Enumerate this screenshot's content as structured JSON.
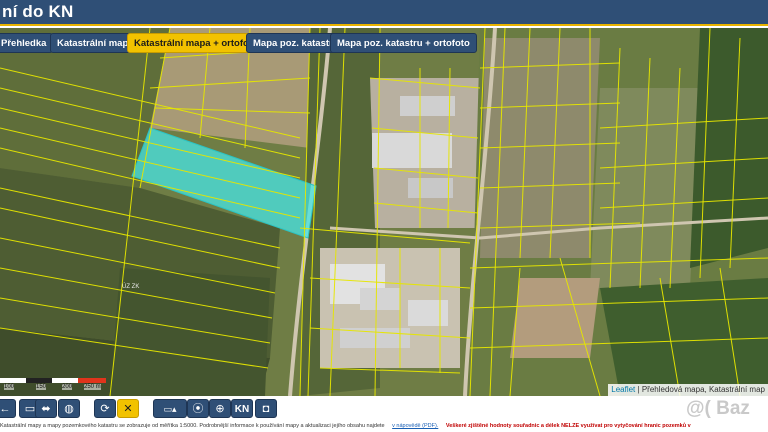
{
  "header": {
    "title": "ní do KN"
  },
  "tabs": [
    {
      "label": "Přehledka",
      "active": false
    },
    {
      "label": "Katastrální mapa",
      "active": false
    },
    {
      "label": "Katastrální mapa + ortofoto",
      "active": true
    },
    {
      "label": "Mapa poz. katastru",
      "active": false
    },
    {
      "label": "Mapa poz. katastru + ortofoto",
      "active": false
    }
  ],
  "map": {
    "parcel_label": "ÚZ ZK",
    "scale_labels": [
      "100",
      "150",
      "200",
      "250 m"
    ],
    "attribution": {
      "leaflet": "Leaflet",
      "text": "| Přehledová mapa, Katastrální map"
    },
    "colors": {
      "parcel_line": "#e6e600",
      "selected": "#46e6e6",
      "accent": "#f2c200",
      "brand": "#2f4f76"
    }
  },
  "toolbar": {
    "buttons": [
      {
        "name": "arrow-left-icon",
        "glyph": "←"
      },
      {
        "name": "arrow-right-icon",
        "glyph": "▭"
      },
      {
        "name": "move-icon",
        "glyph": "⬌"
      },
      {
        "name": "globe-icon",
        "glyph": "◍"
      },
      {
        "name": "refresh-icon",
        "glyph": "⟳"
      },
      {
        "name": "close-icon",
        "glyph": "✕"
      },
      {
        "name": "measure-icon",
        "glyph": "▭▴"
      },
      {
        "name": "location-icon",
        "glyph": "⦿"
      },
      {
        "name": "crosshair-icon",
        "glyph": "⊕"
      },
      {
        "name": "kn-button",
        "glyph": "KN"
      },
      {
        "name": "chat-icon",
        "glyph": "◘"
      }
    ]
  },
  "watermark": "@( Baz",
  "footer": {
    "text": "Katastrální mapy a mapy pozemkového katastru se zobrazuje od měřítka 1:5000. Podrobnější informace k používání mapy a aktualizaci jejího obsahu najdete",
    "link": "v nápovědě (PDF).",
    "warning": "Veškeré zjištěné hodnoty souřadnic a délek NELZE využívat pro vytyčování hranic pozemků v"
  }
}
